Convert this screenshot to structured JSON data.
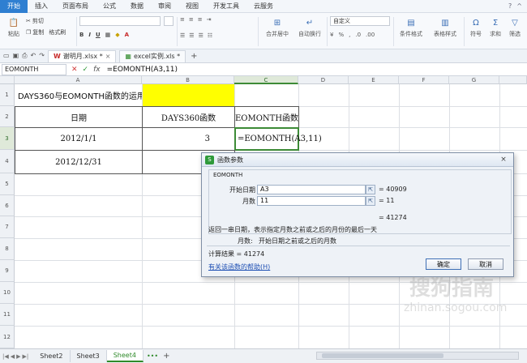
{
  "menu": {
    "items": [
      "开始",
      "插入",
      "页面布局",
      "公式",
      "数据",
      "审阅",
      "视图",
      "开发工具",
      "云服务"
    ],
    "active": "开始"
  },
  "ribbon": {
    "paste": "粘贴",
    "cut": "剪切",
    "copy": "复制",
    "format_painter": "格式刷",
    "merge_center": "合并居中",
    "wrap_text": "自动换行",
    "number_format": "自定义",
    "conditional_format": "条件格式",
    "table_style": "表格样式",
    "symbol": "符号",
    "sum": "求和",
    "filter": "筛选"
  },
  "tabs": [
    {
      "label": "谢明月.xlsx *",
      "active": true
    },
    {
      "label": "excel实例.xls *",
      "active": false
    }
  ],
  "formula_bar": {
    "name_box": "EOMONTH",
    "formula": "=EOMONTH(A3,11)"
  },
  "columns": [
    "A",
    "B",
    "C",
    "D",
    "E",
    "F",
    "G"
  ],
  "selected_column": "C",
  "rows": [
    "1",
    "2",
    "3",
    "4",
    "5",
    "6",
    "7",
    "8",
    "9",
    "10",
    "11",
    "12"
  ],
  "selected_row": "3",
  "cells": {
    "a1": "DAYS360与EOMONTH函数的运用",
    "a2": "日期",
    "b2": "DAYS360函数",
    "c2": "EOMONTH函数",
    "a3": "2012/1/1",
    "b3": "3",
    "c3": "=EOMONTH(A3,11)",
    "a4": "2012/12/31"
  },
  "dialog": {
    "title": "函数参数",
    "function_name": "EOMONTH",
    "args": [
      {
        "label": "开始日期",
        "value": "A3",
        "result": "= 40909"
      },
      {
        "label": "月数",
        "value": "11",
        "result": "= 11"
      }
    ],
    "overall_result": "= 41274",
    "description": "返回一串日期，表示指定月数之前或之后的月份的最后一天",
    "arg_help_label": "月数:",
    "arg_help_text": "开始日期之前或之后的月数",
    "calc_result": "计算结果 = 41274",
    "help_link": "有关该函数的帮助(H)",
    "ok": "确定",
    "cancel": "取消"
  },
  "sheets": [
    {
      "label": "Sheet2",
      "active": false
    },
    {
      "label": "Sheet3",
      "active": false
    },
    {
      "label": "Sheet4",
      "active": true
    }
  ],
  "sheet_more": "•••",
  "add_sheet": "+",
  "watermark": {
    "main": "搜狗指南",
    "sub": "zhinan.sogou.com"
  }
}
